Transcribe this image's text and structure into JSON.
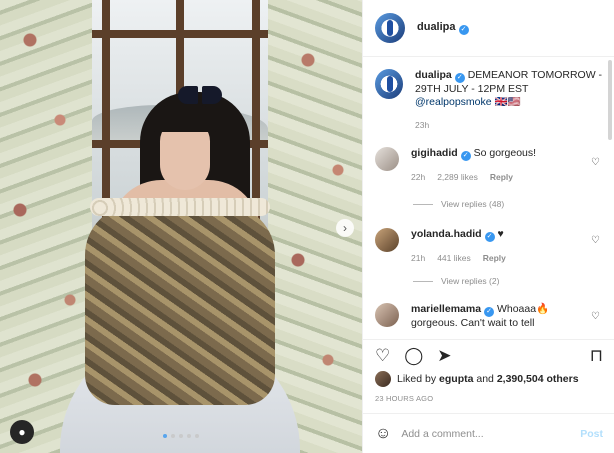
{
  "post": {
    "username": "dualipa",
    "verified": true,
    "caption": {
      "username": "dualipa",
      "text": "DEMEANOR TOMORROW - 29TH JULY - 12PM EST",
      "mention": "@realpopsmoke",
      "trailing": "🇬🇧🇺🇸",
      "time": "23h"
    },
    "carousel": {
      "current": 1,
      "total": 5
    }
  },
  "comments": [
    {
      "username": "gigihadid",
      "text": "So gorgeous!",
      "time": "22h",
      "likes": "2,289 likes",
      "reply": "Reply",
      "view_replies": "View replies (48)"
    },
    {
      "username": "yolanda.hadid",
      "text": "♥",
      "time": "21h",
      "likes": "441 likes",
      "reply": "Reply",
      "view_replies": "View replies (2)"
    },
    {
      "username": "mariellemama",
      "text": "Whoaaa🔥 gorgeous. Can't wait to tell"
    }
  ],
  "engagement": {
    "liked_by_prefix": "Liked by",
    "liked_by_user": "egupta",
    "liked_by_and": "and",
    "liked_by_count": "2,390,504 others",
    "posted": "23 HOURS AGO"
  },
  "add_comment": {
    "placeholder": "Add a comment...",
    "post_label": "Post"
  },
  "icons": {
    "heart": "heart-icon",
    "comment": "comment-icon",
    "share": "share-icon",
    "bookmark": "bookmark-icon",
    "emoji": "emoji-icon",
    "user_tag": "user-tag-icon",
    "next": "chevron-right-icon"
  },
  "colors": {
    "link": "#00376b",
    "verified": "#3897f0",
    "muted": "#8e8e8e",
    "post_disabled": "#b2dffc"
  }
}
